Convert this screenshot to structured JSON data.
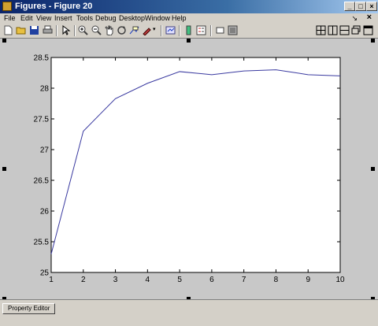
{
  "window": {
    "title": "Figures - Figure 20"
  },
  "title_controls": [
    "_",
    "□",
    "×"
  ],
  "menu": {
    "items": [
      "File",
      "Edit",
      "View",
      "Insert",
      "Tools",
      "Debug",
      "Desktop",
      "Window",
      "Help"
    ],
    "arrow": "↘",
    "close": "×"
  },
  "toolbar": {
    "icons": [
      "new-figure-icon",
      "open-icon",
      "save-icon",
      "print-icon",
      "edit-plot-icon",
      "zoom-in-icon",
      "zoom-out-icon",
      "pan-icon",
      "rotate-3d-icon",
      "data-cursor-icon",
      "brush-icon",
      "link-plot-icon",
      "colorbar-icon",
      "legend-icon",
      "hide-plot-tools-icon",
      "show-plot-tools-icon"
    ],
    "layout_icons": [
      "tile-grid-icon",
      "split-vertical-icon",
      "split-horizontal-icon",
      "float-icon",
      "dock-icon"
    ]
  },
  "bottom": {
    "property_editor": "Property Editor"
  },
  "chart_data": {
    "type": "line",
    "x": [
      1,
      2,
      3,
      4,
      5,
      6,
      7,
      8,
      9,
      10
    ],
    "y": [
      25.3,
      27.3,
      27.83,
      28.08,
      28.27,
      28.22,
      28.28,
      28.3,
      28.22,
      28.2
    ],
    "xlim": [
      1,
      10
    ],
    "ylim": [
      25,
      28.5
    ],
    "xticks": [
      "1",
      "2",
      "3",
      "4",
      "5",
      "6",
      "7",
      "8",
      "9",
      "10"
    ],
    "yticks": [
      "25",
      "25.5",
      "26",
      "26.5",
      "27",
      "27.5",
      "28",
      "28.5"
    ],
    "ytick_values": [
      25,
      25.5,
      26,
      26.5,
      27,
      27.5,
      28,
      28.5
    ],
    "line_color": "#3a3aa0",
    "grid": false
  }
}
